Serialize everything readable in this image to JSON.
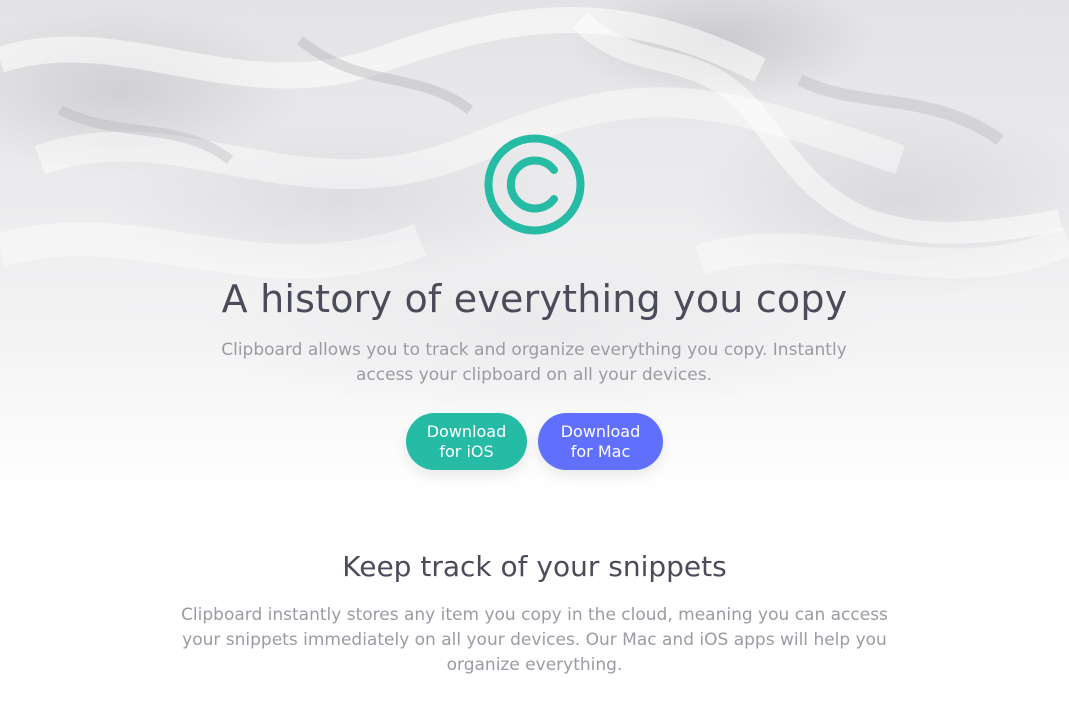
{
  "hero": {
    "title": "A history of everything you copy",
    "subtitle_line1": "Clipboard allows you to track and organize everything you copy. Instantly",
    "subtitle_line2": "access your clipboard on all your devices.",
    "logo_icon": "clipboard-c-logo-icon",
    "buttons": {
      "ios": {
        "line1": "Download",
        "line2": "for iOS",
        "color": "#26bba5"
      },
      "mac": {
        "line1": "Download",
        "line2": "for Mac",
        "color": "#6070fd"
      }
    }
  },
  "snippets": {
    "title": "Keep track of your snippets",
    "body_line1": "Clipboard instantly stores any item you copy in the cloud, meaning you can access",
    "body_line2": "your snippets immediately on all your devices. Our Mac and iOS apps will help you",
    "body_line3": "organize everything."
  },
  "colors": {
    "accent_teal": "#26bba5",
    "accent_blue": "#6070fd",
    "heading": "#4b4c5a",
    "body_text": "#9a9ba3"
  }
}
